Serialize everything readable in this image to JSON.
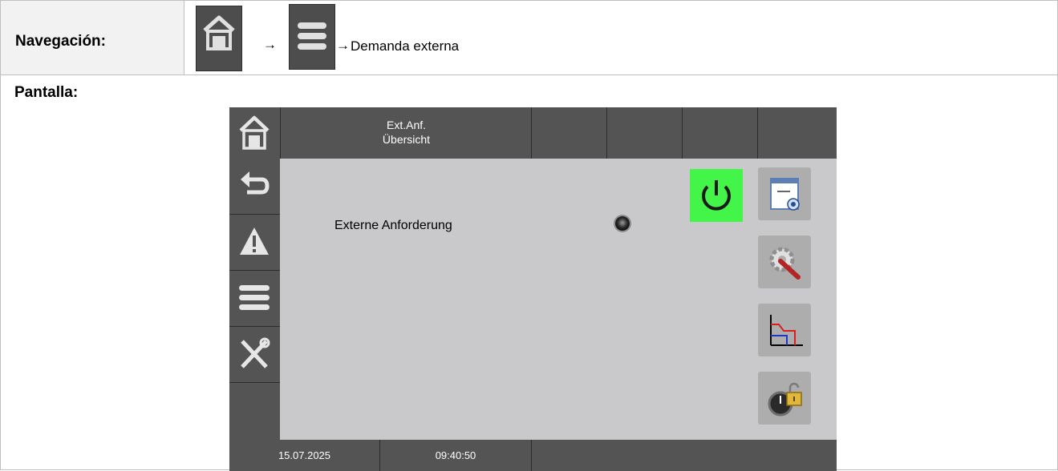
{
  "navigation": {
    "label": "Navegación:",
    "arrow1": "→",
    "arrow2": "→",
    "destination": "Demanda externa"
  },
  "screen_section": {
    "label": "Pantalla:"
  },
  "device_screen": {
    "header": {
      "title_line1": "Ext.Anf.",
      "title_line2": "Übersicht"
    },
    "sidebar": [
      "home-icon",
      "back-icon",
      "warning-icon",
      "menu-icon",
      "tools-icon"
    ],
    "content": {
      "external_request_label": "Externe Anforderung",
      "status_indicator": "off"
    },
    "right_buttons": [
      "power-icon",
      "sensor-view-icon",
      "settings-icon",
      "chart-icon",
      "timer-lock-icon"
    ],
    "footer": {
      "date": "15.07.2025",
      "time": "09:40:50"
    },
    "colors": {
      "panel": "#545454",
      "background": "#c9c8cb",
      "power_active": "#43f548"
    }
  }
}
